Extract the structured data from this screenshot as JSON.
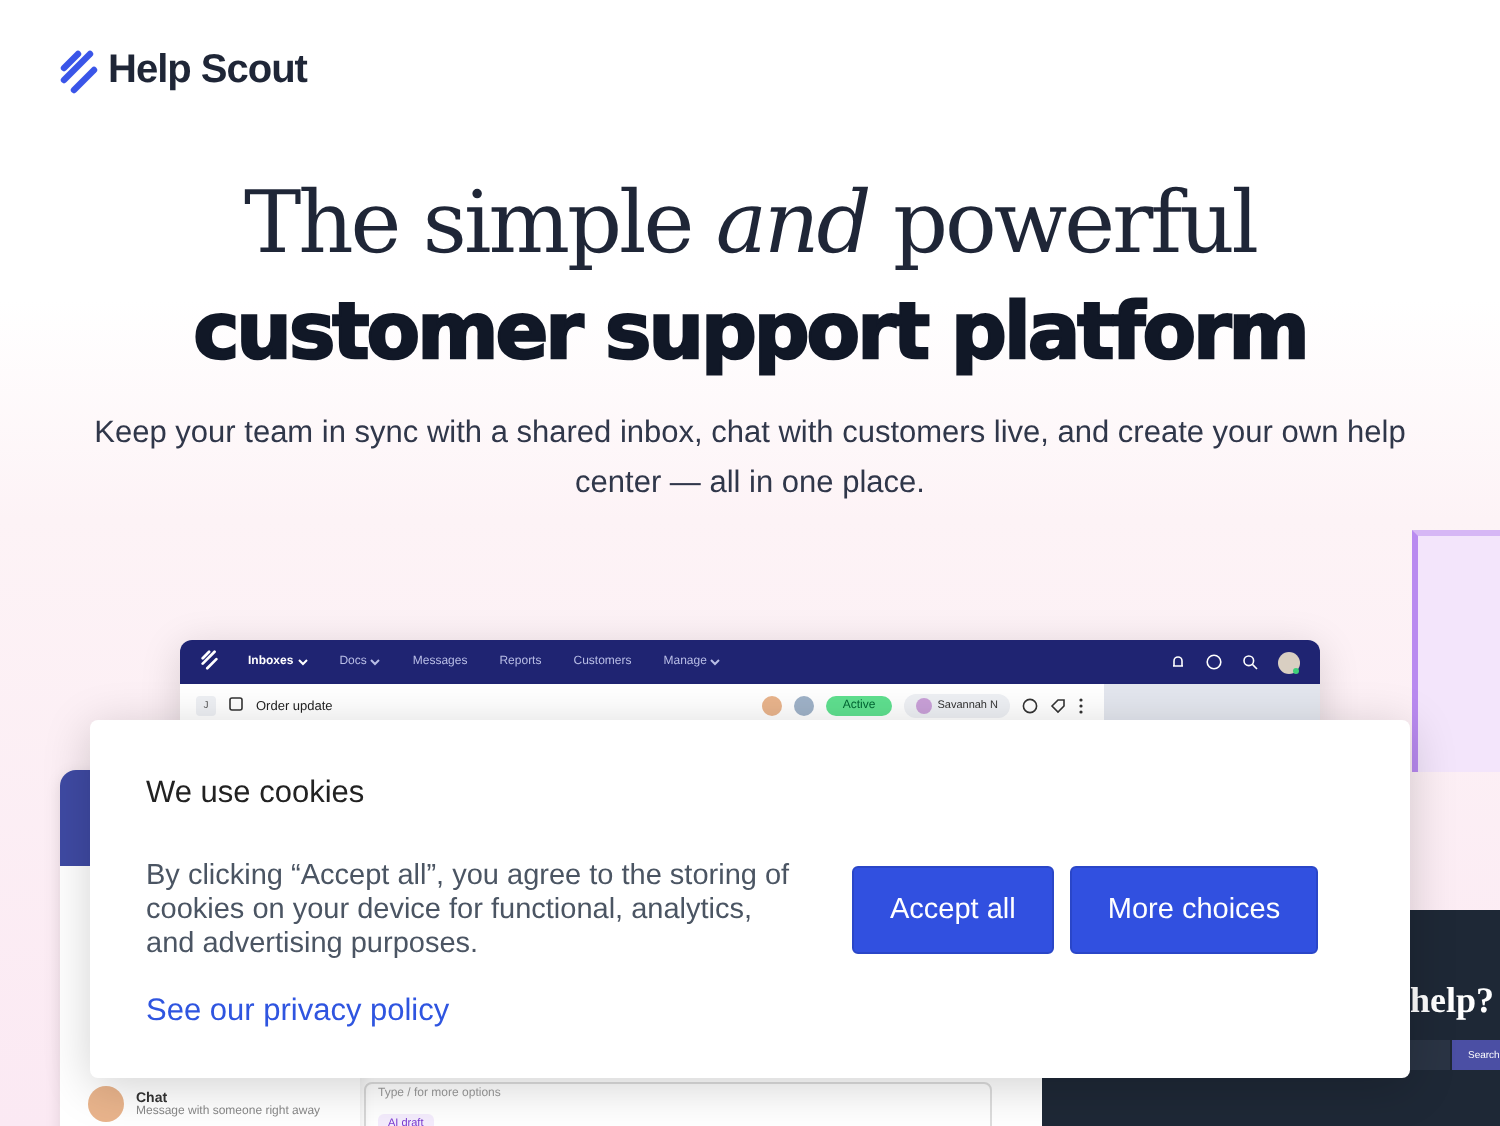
{
  "header": {
    "logo": "Help Scout"
  },
  "hero": {
    "title_line1": "The simple *and* powerful",
    "title_line2": "customer support platform",
    "subtitle": "Keep your team in sync with a shared inbox, chat with customers live, and create your own help center — all in one place."
  },
  "app": {
    "nav": [
      {
        "label": "Inboxes",
        "dropdown": true,
        "selected": true
      },
      {
        "label": "Docs",
        "dropdown": true,
        "selected": false
      },
      {
        "label": "Messages",
        "dropdown": false,
        "selected": false
      },
      {
        "label": "Reports",
        "dropdown": false,
        "selected": false
      },
      {
        "label": "Customers",
        "dropdown": false,
        "selected": false
      },
      {
        "label": "Manage",
        "dropdown": true,
        "selected": false
      }
    ],
    "conversation": {
      "folder_badge": "J",
      "subject": "Order update",
      "status": "Active",
      "assignee": "Savannah N"
    },
    "chat": {
      "title": "Chat",
      "preview": "Message with someone right away"
    },
    "editor": {
      "placeholder": "Type / for more options",
      "ai_button": "AI draft"
    }
  },
  "help_panel": {
    "heading": "help?",
    "search_button": "Search"
  },
  "cookie_banner": {
    "title": "We use cookies",
    "body": "By clicking “Accept all”, you agree to the storing of cookies on your device for functional, analytics, and advertising purposes.",
    "link": "See our privacy policy",
    "buttons": [
      "Accept all",
      "More choices"
    ]
  }
}
